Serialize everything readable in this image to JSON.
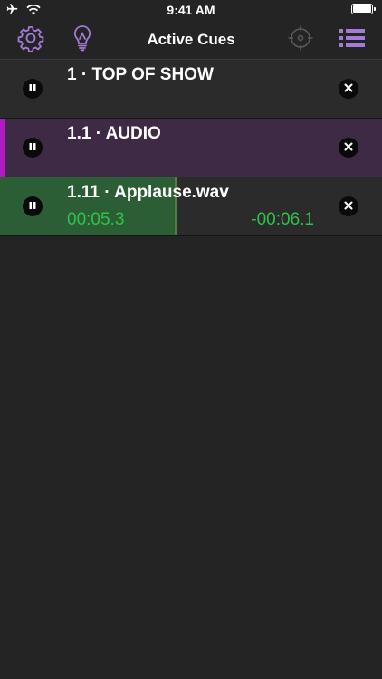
{
  "status_bar": {
    "time": "9:41 AM",
    "icons": [
      "airplane-icon",
      "wifi-icon",
      "battery-icon"
    ]
  },
  "nav": {
    "title": "Active Cues",
    "left_icons": [
      "gear-icon",
      "lightbulb-icon"
    ],
    "right_icons": [
      "crosshair-icon",
      "list-icon"
    ],
    "accent_color": "#a57bd8"
  },
  "cues": [
    {
      "label": "1 · TOP OF SHOW",
      "color": null
    },
    {
      "label": "1.1 · AUDIO",
      "color": "#b21bc3"
    },
    {
      "label": "1.11 · Applause.wav",
      "elapsed": "00:05.3",
      "remaining": "-00:06.1",
      "progress_fraction": 0.46,
      "progress_color": "#2c5e35",
      "time_color": "#2fc24b"
    }
  ]
}
